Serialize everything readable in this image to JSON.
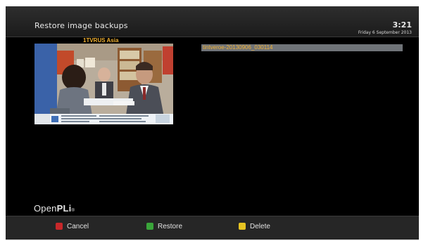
{
  "header": {
    "title": "Restore image backups",
    "time": "3:21",
    "date": "Friday 6 September 2013"
  },
  "preview": {
    "channel_name": "1TVRUS Asia"
  },
  "backups": {
    "items": [
      {
        "label": "tintveroe-20130906_030114"
      }
    ]
  },
  "branding": {
    "logo_light": "Open",
    "logo_strong": "PLi",
    "logo_sub": "®"
  },
  "footer": {
    "buttons": [
      {
        "label": "Cancel",
        "color": "#c7282a",
        "icon": "red-key-icon"
      },
      {
        "label": "Restore",
        "color": "#3aa53a",
        "icon": "green-key-icon"
      },
      {
        "label": "Delete",
        "color": "#e6c322",
        "icon": "yellow-key-icon"
      }
    ]
  },
  "colors": {
    "background": "#000000",
    "accent": "#f2b233",
    "selection": "#6f7378"
  }
}
